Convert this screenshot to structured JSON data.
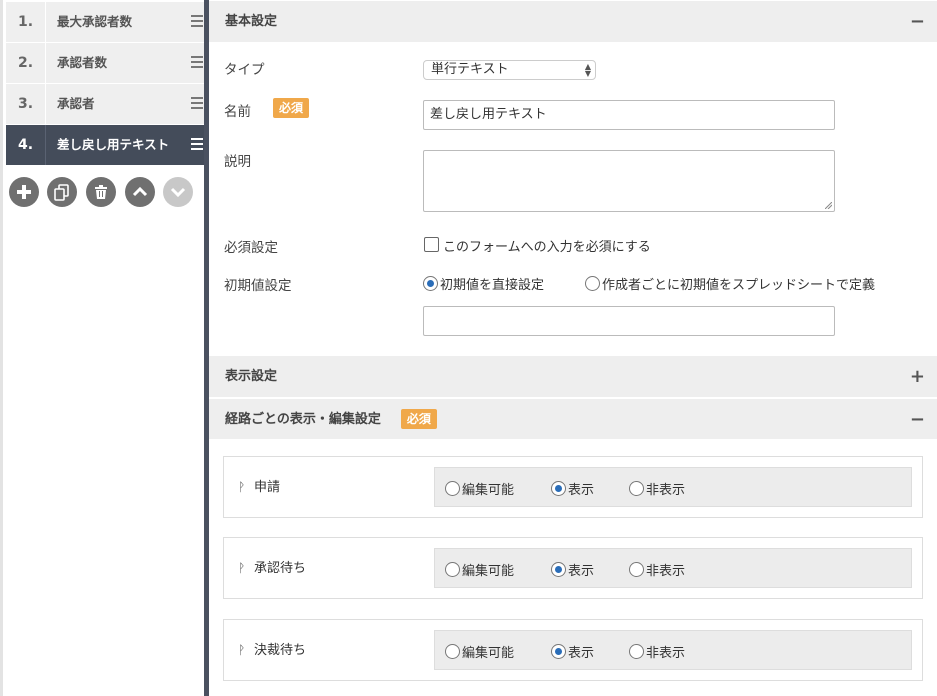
{
  "fields": [
    {
      "num": "1.",
      "label": "最大承認者数"
    },
    {
      "num": "2.",
      "label": "承認者数"
    },
    {
      "num": "3.",
      "label": "承認者"
    },
    {
      "num": "4.",
      "label": "差し戻し用テキスト"
    }
  ],
  "toolbar": {
    "add": "plus-icon",
    "copy": "copy-icon",
    "delete": "trash-icon",
    "up": "chevron-up-icon",
    "down": "chevron-down-icon"
  },
  "basic": {
    "title": "基本設定",
    "toggle": "−",
    "type_label": "タイプ",
    "type_value": "単行テキスト",
    "name_label": "名前",
    "required_badge": "必須",
    "name_value": "差し戻し用テキスト",
    "desc_label": "説明",
    "req_label": "必須設定",
    "req_checkbox": "このフォームへの入力を必須にする",
    "init_label": "初期値設定",
    "init_opt1": "初期値を直接設定",
    "init_opt2": "作成者ごとに初期値をスプレッドシートで定義"
  },
  "display": {
    "title": "表示設定",
    "toggle": "+"
  },
  "route": {
    "title": "経路ごとの表示・編集設定",
    "badge": "必須",
    "toggle": "−",
    "options": [
      "編集可能",
      "表示",
      "非表示"
    ],
    "rows": [
      {
        "name": "申請",
        "selected": 1
      },
      {
        "name": "承認待ち",
        "selected": 1
      },
      {
        "name": "決裁待ち",
        "selected": 1
      }
    ]
  },
  "colors": {
    "active_item": "#444c5a",
    "badge": "#f0a84a",
    "radio_on": "#2a6db8"
  }
}
